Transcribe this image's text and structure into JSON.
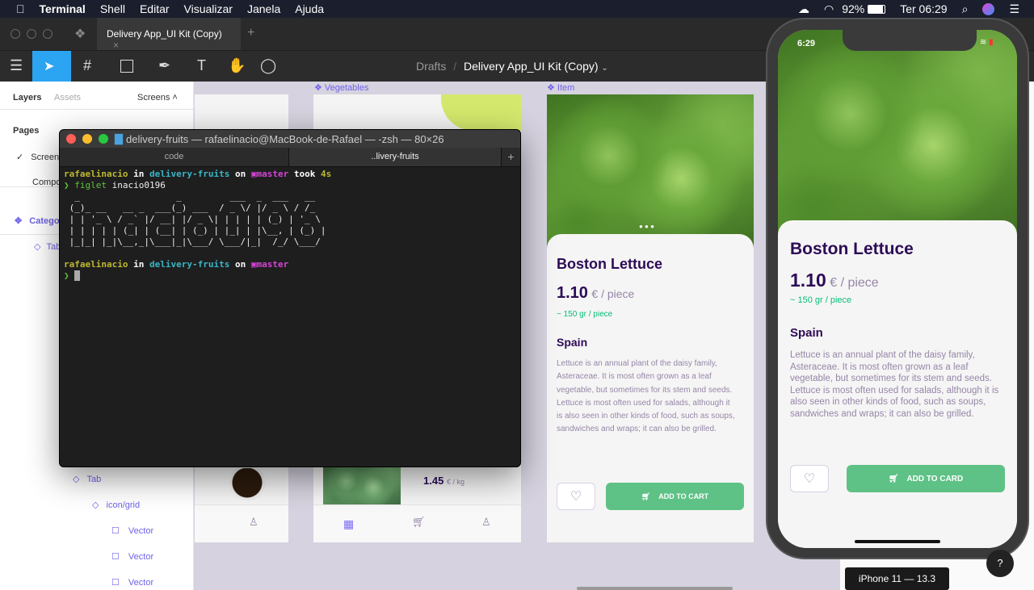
{
  "menubar": {
    "app": "Terminal",
    "items": [
      "Shell",
      "Editar",
      "Visualizar",
      "Janela",
      "Ajuda"
    ],
    "battery": "92%",
    "clock": "Ter 06:29"
  },
  "figma": {
    "tab_title": "Delivery App_UI Kit (Copy)",
    "breadcrumb_root": "Drafts",
    "breadcrumb_file": "Delivery App_UI Kit (Copy)",
    "panel": {
      "tab_layers": "Layers",
      "tab_assets": "Assets",
      "page_selector": "Screens",
      "pages_label": "Pages",
      "pages": [
        "Screens",
        "Components"
      ],
      "layers": [
        {
          "label": "Categories",
          "type": "component"
        },
        {
          "label": "Tab",
          "type": "instance"
        },
        {
          "label": "Tab",
          "type": "instance"
        },
        {
          "label": "icon/grid",
          "type": "instance"
        },
        {
          "label": "Vector",
          "type": "vector"
        },
        {
          "label": "Vector",
          "type": "vector"
        },
        {
          "label": "Vector",
          "type": "vector"
        }
      ]
    },
    "frames": {
      "vegetables_label": "Vegetables",
      "item_label": "Item",
      "veg_price": "1.45",
      "veg_unit": "€ / kg"
    },
    "device_label": "iPhone 11 — 13.3",
    "help": "?"
  },
  "product": {
    "name": "Boston Lettuce",
    "price": "1.10",
    "unit": "€ / piece",
    "weight": "~ 150 gr / piece",
    "origin": "Spain",
    "description": "Lettuce is an annual plant of the daisy family, Asteraceae. It is most often grown as a leaf vegetable, but sometimes for its stem and seeds. Lettuce is most often used for salads, although it is also seen in other kinds of food, such as soups, sandwiches and wraps; it can also be grilled.",
    "canvas_button": "ADD TO CART",
    "phone_button": "ADD TO CARD"
  },
  "phone": {
    "time": "6:29"
  },
  "terminal": {
    "title": "delivery-fruits — rafaelinacio@MacBook-de-Rafael — -zsh — 80×26",
    "tabs": [
      "code",
      "..livery-fruits"
    ],
    "user": "rafaelinacio",
    "in": "in",
    "dir": "delivery-fruits",
    "on": "on",
    "branch": "master",
    "took": "took",
    "duration": "4s",
    "command": "figlet",
    "arg": "inacio0196",
    "figlet": "  _                  _         ___  _  ___   __ \n (_)_ __   __ _  ___(_) ___  / _ \\/ |/ _ \\ / /_ \n | | '_ \\ / _` |/ __| |/ _ \\| | | | | (_) | '_ \\\n | | | | | (_| | (__| | (_) | |_| | |\\__, | (_) |\n |_|_| |_|\\__,_|\\___|_|\\___/ \\___/|_|  /_/ \\___/"
  }
}
